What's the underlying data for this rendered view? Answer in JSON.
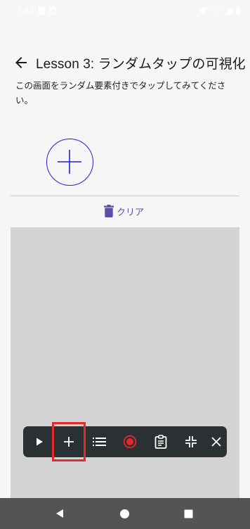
{
  "status_bar": {
    "time": "7:53",
    "network": "LTE"
  },
  "app_bar": {
    "title": "Lesson 3: ランダムタップの可視化"
  },
  "content": {
    "description": "この画面をランダム要素付きでタップしてみてください。",
    "clear_label": "クリア"
  },
  "toolbar": {
    "buttons": [
      "play-icon",
      "plus-icon",
      "list-icon",
      "record-icon",
      "clipboard-icon",
      "collapse-icon",
      "close-icon"
    ],
    "record_color": "#e8262d",
    "highlight_color": "#e32b2b"
  },
  "colors": {
    "target_circle": "#1f1fe0",
    "clear_accent": "#5b4fa3",
    "tap_area": "#d3d3d3",
    "toolbar_bg": "#2b3033",
    "nav_bar": "#545454"
  }
}
